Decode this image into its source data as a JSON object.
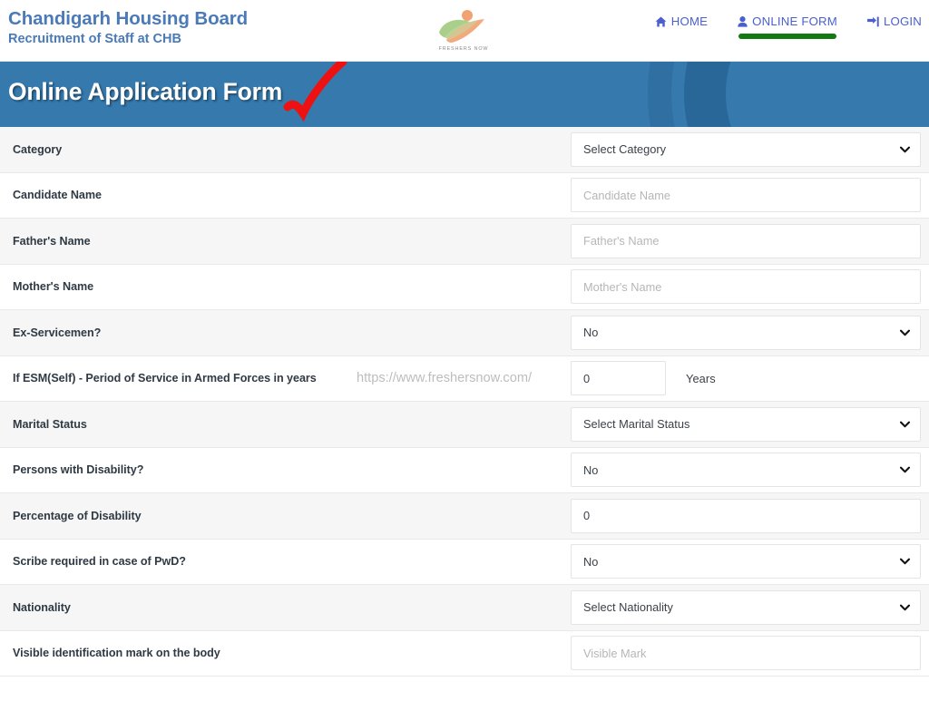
{
  "header": {
    "brand_title": "Chandigarh Housing Board",
    "brand_subtitle": "Recruitment of Staff at CHB",
    "logo_text": "FRESHERS NOW",
    "nav": [
      {
        "label": "HOME",
        "icon": "home-icon",
        "active": false
      },
      {
        "label": "ONLINE FORM",
        "icon": "user-icon",
        "active": true
      },
      {
        "label": "LOGIN",
        "icon": "sign-in-icon",
        "active": false
      }
    ],
    "nav_link_color": "#4a5fd0",
    "active_underline_color": "#137a11"
  },
  "banner": {
    "title": "Online Application Form",
    "background_color": "#3679ad",
    "annotation": "red-check-mark",
    "annotation_color": "#ee1111"
  },
  "watermark": "https://www.freshersnow.com/",
  "form": {
    "rows": [
      {
        "label": "Category",
        "control": "select",
        "value": "Select Category",
        "is_placeholder": false,
        "shaded": true
      },
      {
        "label": "Candidate Name",
        "control": "input",
        "value": "",
        "placeholder": "Candidate Name",
        "is_placeholder": true,
        "shaded": false
      },
      {
        "label": "Father's Name",
        "control": "input",
        "value": "",
        "placeholder": "Father's Name",
        "is_placeholder": true,
        "shaded": true
      },
      {
        "label": "Mother's Name",
        "control": "input",
        "value": "",
        "placeholder": "Mother's Name",
        "is_placeholder": true,
        "shaded": false
      },
      {
        "label": "Ex-Servicemen?",
        "control": "select",
        "value": "No",
        "is_placeholder": false,
        "shaded": true
      },
      {
        "label": "If ESM(Self) - Period of Service in Armed Forces in years",
        "control": "input-small",
        "value": "0",
        "unit": "Years",
        "is_placeholder": false,
        "shaded": false,
        "has_watermark": true
      },
      {
        "label": "Marital Status",
        "control": "select",
        "value": "Select Marital Status",
        "is_placeholder": false,
        "shaded": true
      },
      {
        "label": "Persons with Disability?",
        "control": "select",
        "value": "No",
        "is_placeholder": false,
        "shaded": false
      },
      {
        "label": "Percentage of Disability",
        "control": "input",
        "value": "0",
        "placeholder": "0",
        "is_placeholder": false,
        "shaded": true
      },
      {
        "label": "Scribe required in case of PwD?",
        "control": "select",
        "value": "No",
        "is_placeholder": false,
        "shaded": false
      },
      {
        "label": "Nationality",
        "control": "select",
        "value": "Select Nationality",
        "is_placeholder": false,
        "shaded": true
      },
      {
        "label": "Visible identification mark on the body",
        "control": "input",
        "value": "",
        "placeholder": "Visible Mark",
        "is_placeholder": true,
        "shaded": false
      }
    ]
  }
}
